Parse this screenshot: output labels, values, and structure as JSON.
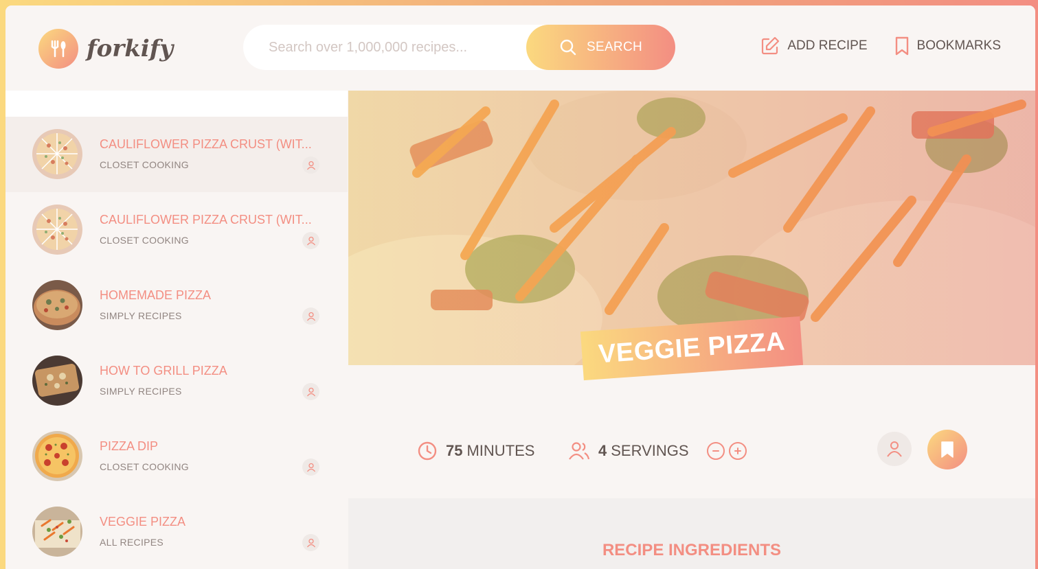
{
  "app": {
    "name": "forkify"
  },
  "search": {
    "placeholder": "Search over 1,000,000 recipes...",
    "button_label": "SEARCH"
  },
  "nav": {
    "add_recipe": "ADD RECIPE",
    "bookmarks": "BOOKMARKS"
  },
  "results": [
    {
      "title": "CAULIFLOWER PIZZA CRUST (WIT...",
      "publisher": "CLOSET COOKING"
    },
    {
      "title": "CAULIFLOWER PIZZA CRUST (WIT...",
      "publisher": "CLOSET COOKING"
    },
    {
      "title": "HOMEMADE PIZZA",
      "publisher": "SIMPLY RECIPES"
    },
    {
      "title": "HOW TO GRILL PIZZA",
      "publisher": "SIMPLY RECIPES"
    },
    {
      "title": "PIZZA DIP",
      "publisher": "CLOSET COOKING"
    },
    {
      "title": "VEGGIE PIZZA",
      "publisher": "ALL RECIPES"
    }
  ],
  "recipe": {
    "title": "VEGGIE PIZZA",
    "cooking_time": "75",
    "cooking_time_unit": "MINUTES",
    "servings": "4",
    "servings_unit": "SERVINGS",
    "ingredients_heading": "RECIPE INGREDIENTS"
  },
  "colors": {
    "accent_start": "#fbd97f",
    "accent_end": "#f38e82",
    "text": "#615551"
  }
}
